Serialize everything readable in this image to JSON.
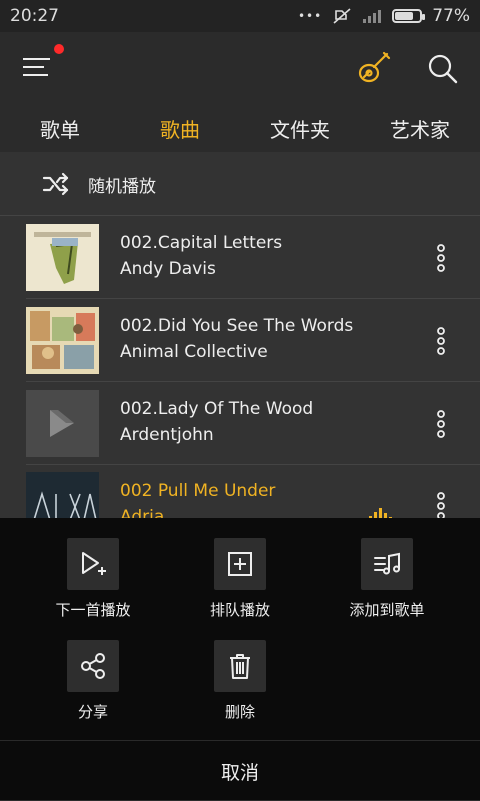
{
  "status": {
    "time": "20:27",
    "dots": "•••",
    "battery": "77%"
  },
  "tabs": [
    {
      "label": "歌单",
      "active": false
    },
    {
      "label": "歌曲",
      "active": true
    },
    {
      "label": "文件夹",
      "active": false
    },
    {
      "label": "艺术家",
      "active": false
    }
  ],
  "shuffle_label": "随机播放",
  "songs": [
    {
      "title": "002.Capital Letters",
      "artist": "Andy Davis",
      "playing": false,
      "cover_icon": "album-art-leaf"
    },
    {
      "title": "002.Did You See The Words",
      "artist": "Animal Collective",
      "playing": false,
      "cover_icon": "album-art-painting"
    },
    {
      "title": "002.Lady Of The Wood",
      "artist": "Ardentjohn",
      "playing": false,
      "cover_icon": "default-album-play"
    },
    {
      "title": "002  Pull Me Under",
      "artist": "Adria",
      "playing": true,
      "cover_icon": "album-art-dark"
    }
  ],
  "actions": [
    {
      "label": "下一首播放",
      "icon": "play-next-icon"
    },
    {
      "label": "排队播放",
      "icon": "queue-add-icon"
    },
    {
      "label": "添加到歌单",
      "icon": "add-to-playlist-icon"
    },
    {
      "label": "分享",
      "icon": "share-icon"
    },
    {
      "label": "删除",
      "icon": "trash-icon"
    }
  ],
  "cancel_label": "取消",
  "colors": {
    "accent": "#f0b323",
    "notification_dot": "#ff2a2a",
    "background": "#2b2b2b",
    "sheet": "#0b0b0b"
  }
}
